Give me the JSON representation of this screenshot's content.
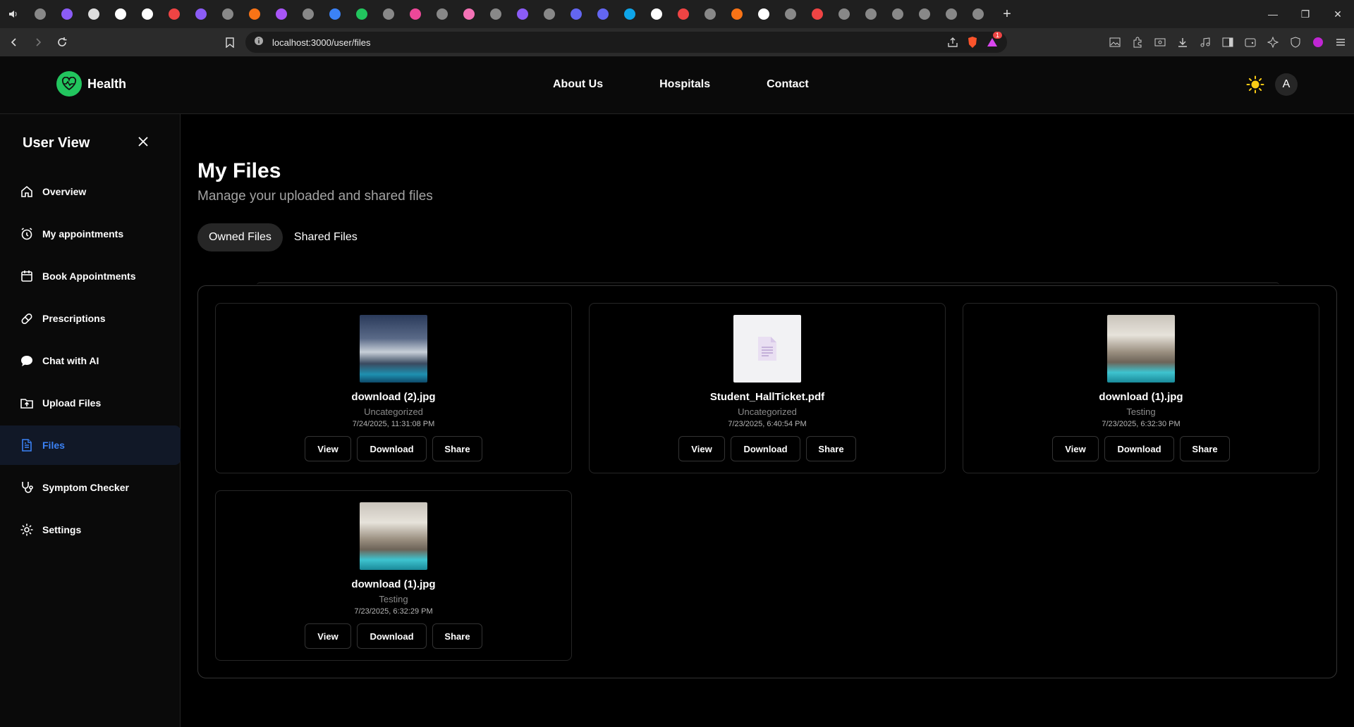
{
  "browser": {
    "url": "localhost:3000/user/files",
    "notification_count": "1",
    "tab_colors": [
      "#888",
      "#8b5cf6",
      "#ddd",
      "#fff",
      "#fff",
      "#ef4444",
      "#8b5cf6",
      "#888",
      "#f97316",
      "#a855f7",
      "#888",
      "#3b82f6",
      "#22c55e",
      "#888",
      "#ec4899",
      "#888",
      "#f472b6",
      "#888",
      "#8b5cf6",
      "#888",
      "#6366f1",
      "#6366f1",
      "#0ea5e9",
      "#fff",
      "#ef4444",
      "#888",
      "#f97316",
      "#fff",
      "#888",
      "#ef4444",
      "#888",
      "#888",
      "#888",
      "#888",
      "#888",
      "#888"
    ]
  },
  "header": {
    "brand": "Health",
    "nav": [
      "About Us",
      "Hospitals",
      "Contact"
    ],
    "avatar_initial": "A"
  },
  "sidebar": {
    "title": "User View",
    "items": [
      {
        "label": "Overview",
        "icon": "home-icon"
      },
      {
        "label": "My appointments",
        "icon": "alarm-clock-icon"
      },
      {
        "label": "Book Appointments",
        "icon": "calendar-icon"
      },
      {
        "label": "Prescriptions",
        "icon": "pill-icon"
      },
      {
        "label": "Chat with AI",
        "icon": "chat-bubble-icon"
      },
      {
        "label": "Upload Files",
        "icon": "folder-upload-icon"
      },
      {
        "label": "Files",
        "icon": "file-text-icon",
        "active": true
      },
      {
        "label": "Symptom Checker",
        "icon": "stethoscope-icon"
      },
      {
        "label": "Settings",
        "icon": "gear-icon"
      }
    ]
  },
  "main": {
    "title": "My Files",
    "subtitle": "Manage your uploaded and shared files",
    "tabs": [
      "Owned Files",
      "Shared Files"
    ],
    "files": [
      {
        "name": "download (2).jpg",
        "category": "Uncategorized",
        "date": "7/24/2025, 11:31:08 PM",
        "thumb": "image-villa-night"
      },
      {
        "name": "Student_HallTicket.pdf",
        "category": "Uncategorized",
        "date": "7/23/2025, 6:40:54 PM",
        "thumb": "pdf-document-icon"
      },
      {
        "name": "download (1).jpg",
        "category": "Testing",
        "date": "7/23/2025, 6:32:30 PM",
        "thumb": "image-villa-pool"
      },
      {
        "name": "download (1).jpg",
        "category": "Testing",
        "date": "7/23/2025, 6:32:29 PM",
        "thumb": "image-villa-pool"
      }
    ],
    "actions": {
      "view": "View",
      "download": "Download",
      "share": "Share"
    }
  }
}
